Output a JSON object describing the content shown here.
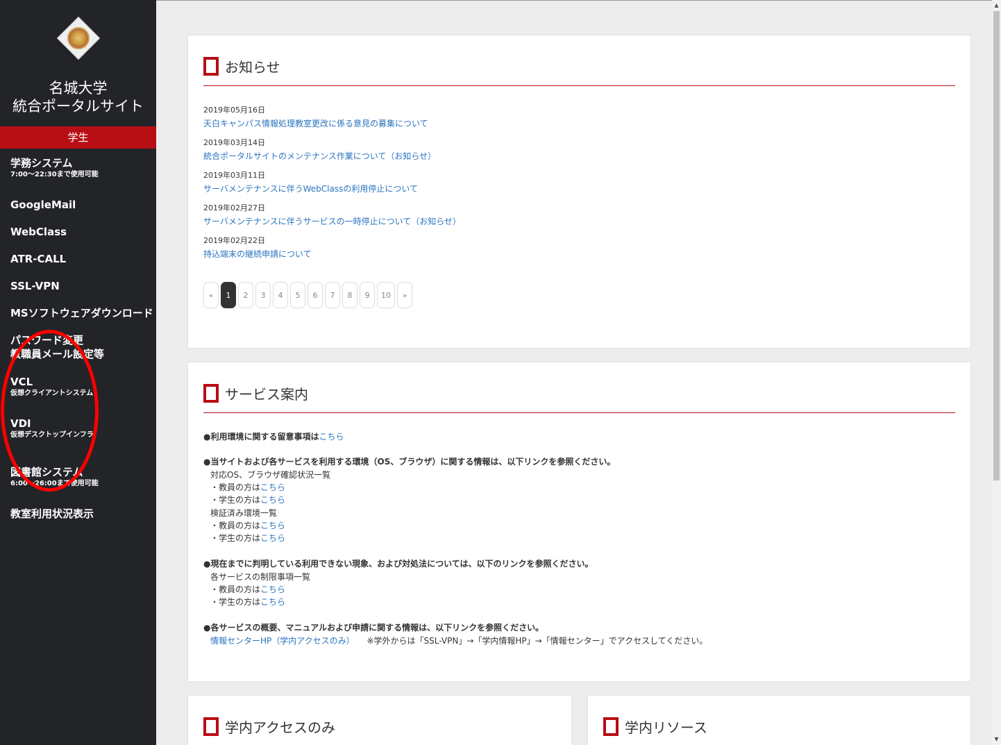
{
  "sidebar": {
    "logo": "university-seal",
    "title_line1": "名城大学",
    "title_line2": "統合ポータルサイト",
    "role": "学生",
    "items": [
      {
        "label": "学務システム",
        "sub": "7:00～22:30まで使用可能"
      },
      {
        "label": "GoogleMail",
        "sub": ""
      },
      {
        "label": "WebClass",
        "sub": ""
      },
      {
        "label": "ATR-CALL",
        "sub": ""
      },
      {
        "label": "SSL-VPN",
        "sub": ""
      },
      {
        "label": "MSソフトウェアダウンロード",
        "sub": ""
      },
      {
        "label": "パスワード変更",
        "label2": "教職員メール設定等"
      },
      {
        "label": "VCL",
        "sub": "仮想クライアントシステム"
      },
      {
        "label": "VDI",
        "sub": "仮想デスクトップインフラ"
      },
      {
        "label": "図書館システム",
        "sub": "6:00～26:00まで使用可能"
      },
      {
        "label": "教室利用状況表示",
        "sub": ""
      }
    ]
  },
  "annotation_color": "#ff0000",
  "news": {
    "title": "お知らせ",
    "items": [
      {
        "date": "2019年05月16日",
        "title": "天白キャンパス情報処理教室更改に係る意見の募集について"
      },
      {
        "date": "2019年03月14日",
        "title": "統合ポータルサイトのメンテナンス作業について（お知らせ）"
      },
      {
        "date": "2019年03月11日",
        "title": "サーバメンテナンスに伴うWebClassの利用停止について"
      },
      {
        "date": "2019年02月27日",
        "title": "サーバメンテナンスに伴うサービスの一時停止について（お知らせ）"
      },
      {
        "date": "2019年02月22日",
        "title": "持込端末の継続申請について"
      }
    ],
    "pager": {
      "prev": "«",
      "pages": [
        "1",
        "2",
        "3",
        "4",
        "5",
        "6",
        "7",
        "8",
        "9",
        "10"
      ],
      "current": "1",
      "next": "»"
    }
  },
  "services": {
    "title": "サービス案内",
    "l1_text": "●利用環境に関する留意事項は",
    "l1_link": "こちら",
    "l2": "●当サイトおよび各サービスを利用する環境（OS、ブラウザ）に関する情報は、以下リンクを参照ください。",
    "l3": "対応OS、ブラウザ確認状況一覧",
    "faculty_prefix": "・教員の方は",
    "student_prefix": "・学生の方は",
    "link_text": "こちら",
    "l6": "検証済み環境一覧",
    "l9": "●現在までに判明している利用できない現象、および対処法については、以下のリンクを参照ください。",
    "l10": "各サービスの制限事項一覧",
    "l13": "●各サービスの概要、マニュアルおよび申請に関する情報は、以下リンクを参照ください。",
    "l14_link": "情報センターHP（学内アクセスのみ）",
    "l14_note": "※学外からは「SSL-VPN」→「学内情報HP」→「情報センター」でアクセスしてください。"
  },
  "campus_only": {
    "title": "学内アクセスのみ"
  },
  "campus_resources": {
    "title": "学内リソース"
  },
  "colors": {
    "sidebar_bg": "#222428",
    "accent": "#b80e15",
    "link": "#2a74c0"
  }
}
